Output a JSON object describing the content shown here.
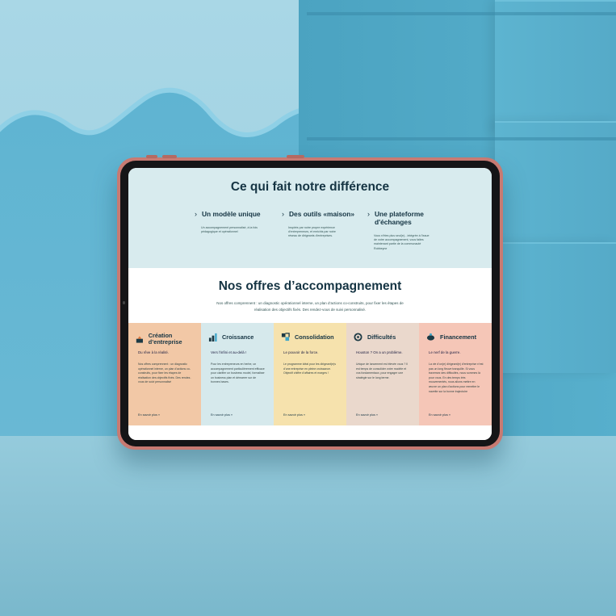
{
  "colors": {
    "tablet_frame": "#c77a72",
    "section_bg": "#d8ebee",
    "heading_text": "#153443",
    "offer_colors": [
      "#f2c8a6",
      "#d6e9ec",
      "#f6e2ad",
      "#ead8cc",
      "#f5c6b7"
    ]
  },
  "difference": {
    "title": "Ce qui fait notre différence",
    "items": [
      {
        "title": "Un modèle unique",
        "text": "Un accompagnement personnalisé, à la fois pédagogique et opérationnel"
      },
      {
        "title": "Des outils «maison»",
        "text": "Inspirés par notre propre expérience d'entrepreneurs, et enrichis par notre réseau de dirigeants d'entreprises."
      },
      {
        "title": "Une plateforme d'échanges",
        "text": "Vous n'êtes plus seul(e)…intégrée à l'issue de votre accompagnement, vous faites maintenant partie de la communauté Robbeyne"
      }
    ]
  },
  "offers_section": {
    "title": "Nos offres d’accompagnement",
    "intro": "Nos offres comprennent : un diagnostic opérationnel interne, un plan d’actions co-construits, pour fixer les étapes de réalisation des objectifs fixés. Des rendez-vous de suivi personnalisé.",
    "items": [
      {
        "icon": "creation-icon",
        "title": "Création d’entreprise",
        "tagline": "Du rêve à la réalité.",
        "text": "Nos offres comprennent : un diagnostic opérationnel interne, un plan d’actions co-construits, pour fixer les étapes de réalisation des objectifs fixés. Des rendez-vous de suivi personnalisé",
        "link": "En savoir plus »"
      },
      {
        "icon": "growth-icon",
        "title": "Croissance",
        "tagline": "Vers l’infini et au-delà !",
        "text": "Pour les entrepreneurs en herbe, un accompagnement particulièrement efficace pour clarifier un business model, formaliser un business plan et démarrer sur de bonnes bases.",
        "link": "En savoir plus »"
      },
      {
        "icon": "consolidation-icon",
        "title": "Consolidation",
        "tagline": "Le pouvoir de la force.",
        "text": "Le programme idéal pour les dirigeant(e)s d’une entreprise en pleine croissance. Objectif chiffre d’affaires et marges !",
        "link": "En savoir plus »"
      },
      {
        "icon": "difficulties-icon",
        "title": "Difficultés",
        "tagline": "Houston ? On a un problème.",
        "text": "Unique de lancement est élevée vous ? Il est temps de consolider votre modèle et vos fondamentaux, pour engager une stratégie sur le long terme.",
        "link": "En savoir plus »"
      },
      {
        "icon": "piggy-bank-icon",
        "title": "Financement",
        "tagline": "Le nerf de la guerre.",
        "text": "La vie d’un(e) dirigeant(e) d’entreprise n’est pas un long fleuve tranquille. Si vous traversez des difficultés, nous sommes là pour vous. En des temps très mouvementés, nous allons mettre en œuvre un plan d’actions pour remettre le navette sur la bonne trajectoire",
        "link": "En savoir plus »"
      }
    ]
  }
}
